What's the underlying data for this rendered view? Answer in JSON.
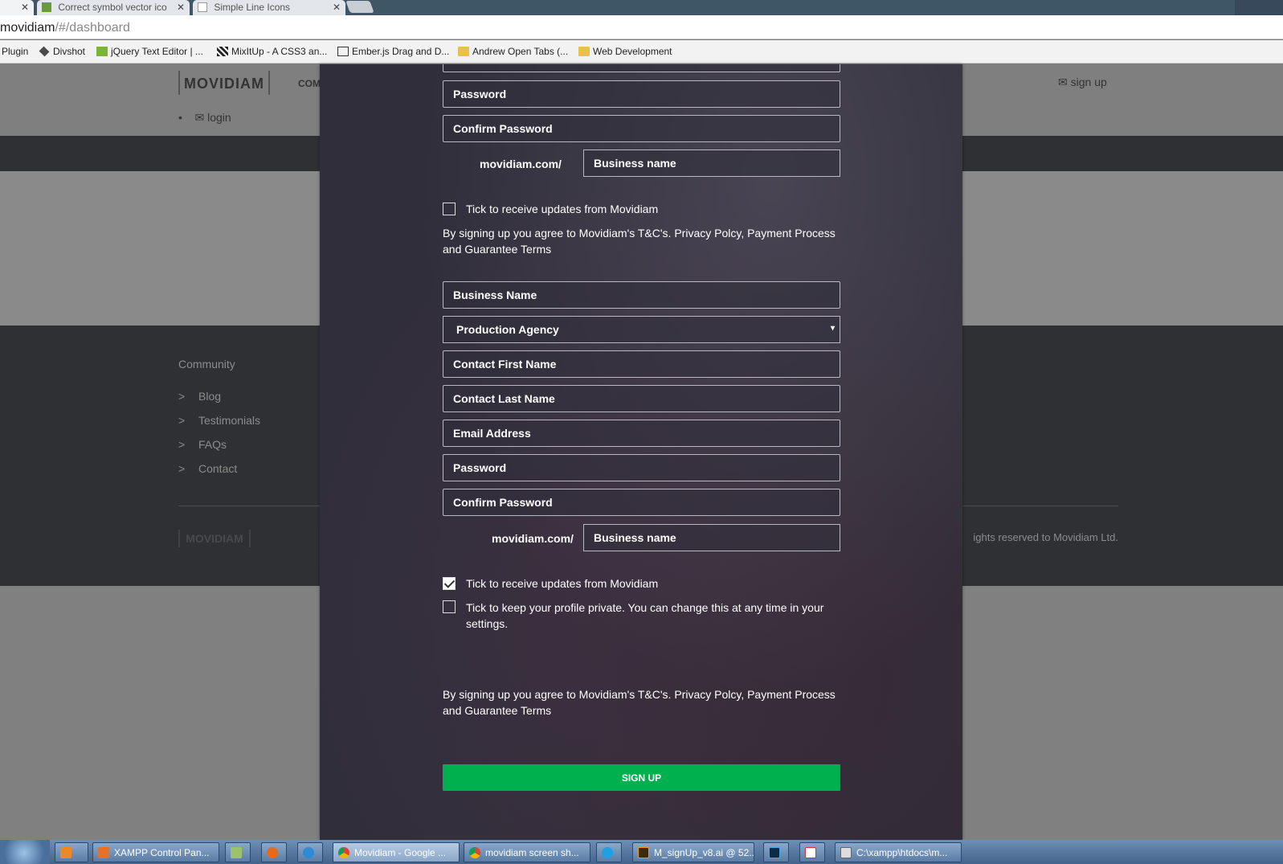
{
  "browser": {
    "tabs": [
      {
        "label": "Correct symbol vector ico",
        "close": "✕"
      },
      {
        "label": "Simple Line Icons",
        "close": "✕"
      }
    ],
    "first_tab_close": "✕",
    "address": {
      "host": "movidiam",
      "path": "/#/dashboard"
    },
    "bookmarks": [
      "Plugin",
      "Divshot",
      "jQuery Text Editor | ...",
      "MixItUp - A CSS3 an...",
      "Ember.js Drag and D...",
      "Andrew Open Tabs (...",
      "Web Development"
    ]
  },
  "site": {
    "logo": "MOVIDIAM",
    "nav_partial": "COM",
    "signup": "sign up",
    "login": "login",
    "footer": {
      "title": "Community",
      "arrow": ">",
      "links": [
        "Blog",
        "Testimonials",
        "FAQs",
        "Contact"
      ],
      "logo": "MOVIDIAM",
      "copyright": "ights reserved to Movidiam Ltd."
    }
  },
  "modal": {
    "form1": {
      "password": "Password",
      "confirm_password": "Confirm Password",
      "url_prefix": "movidiam.com/",
      "business_name": "Business name",
      "updates_label": "Tick to receive updates from Movidiam",
      "updates_checked": false,
      "terms": "By signing up you agree to Movidiam's T&C's. Privacy Polcy, Payment Process and Guarantee Terms"
    },
    "form2": {
      "business_name": "Business Name",
      "business_type": "Production Agency",
      "business_type_caret": "▾",
      "contact_first": "Contact First Name",
      "contact_last": "Contact Last Name",
      "email": "Email Address",
      "password": "Password",
      "confirm_password": "Confirm Password",
      "url_prefix": "movidiam.com/",
      "business_url": "Business name",
      "updates_label": "Tick to receive updates from Movidiam",
      "updates_checked": true,
      "private_label": "Tick to keep your profile private. You can change this at any time in your settings.",
      "private_checked": false,
      "terms": "By signing up you agree to Movidiam's T&C's. Privacy Polcy, Payment Process and Guarantee Terms",
      "submit": "SIGN UP"
    },
    "colors": {
      "button": "#00b04f",
      "backdrop": "#2f2e3a"
    }
  },
  "taskbar": {
    "items": [
      "XAMPP Control Pan...",
      "Movidiam - Google ...",
      "movidiam screen sh...",
      "M_signUp_v8.ai @ 52...",
      "C:\\xampp\\htdocs\\m..."
    ]
  }
}
